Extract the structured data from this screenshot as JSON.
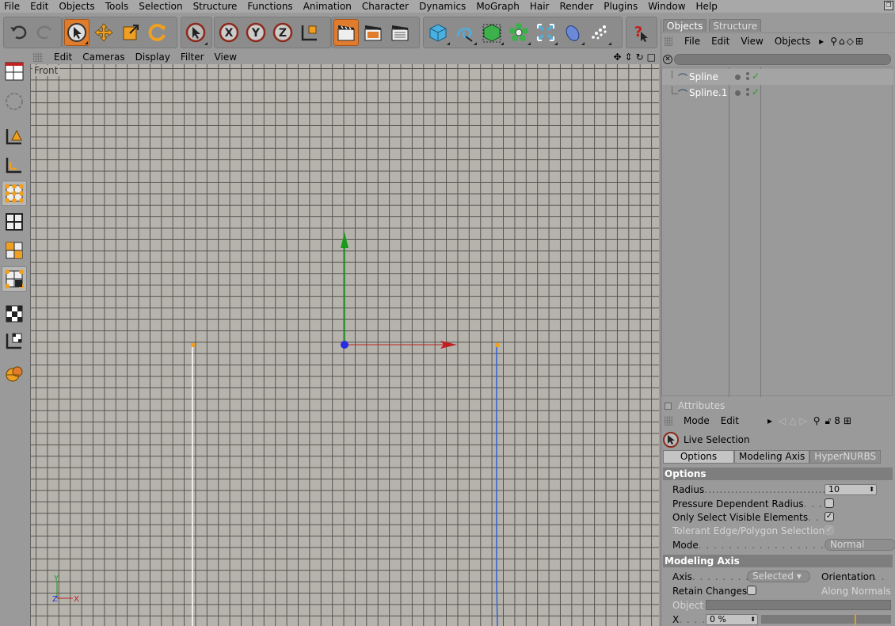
{
  "menubar": {
    "items": [
      "File",
      "Edit",
      "Objects",
      "Tools",
      "Selection",
      "Structure",
      "Functions",
      "Animation",
      "Character",
      "Dynamics",
      "MoGraph",
      "Hair",
      "Render",
      "Plugins",
      "Window",
      "Help"
    ]
  },
  "toolbar": {
    "icons": [
      "undo-icon",
      "redo-icon",
      "live-selection-icon",
      "move-icon",
      "scale-icon",
      "rotate-icon",
      "selected-tool-icon",
      "x-axis-icon",
      "y-axis-icon",
      "z-axis-icon",
      "coordinate-system-icon",
      "render-view-icon",
      "render-picture-viewer-icon",
      "render-settings-icon",
      "cube-icon",
      "spline-pen-icon",
      "nurbs-icon",
      "modeling-array-icon",
      "deformer-icon",
      "scene-floor-icon",
      "particle-icon",
      "help-icon"
    ],
    "x_label": "X",
    "y_label": "Y",
    "z_label": "Z"
  },
  "viewport": {
    "menu": [
      "Edit",
      "Cameras",
      "Display",
      "Filter",
      "View"
    ],
    "view_name": "Front",
    "axis_labels": {
      "x": "X",
      "y": "Y",
      "z": "Z"
    }
  },
  "objects_panel": {
    "tabs": [
      "Objects",
      "Structure"
    ],
    "menu": [
      "File",
      "Edit",
      "View",
      "Objects"
    ],
    "objects": [
      {
        "name": "Spline"
      },
      {
        "name": "Spline.1"
      }
    ]
  },
  "attributes_panel": {
    "title": "Attributes",
    "menu": [
      "Mode",
      "Edit"
    ],
    "tool_name": "Live Selection",
    "tabs": [
      "Options",
      "Modeling Axis",
      "HyperNURBS"
    ],
    "options_section": "Options",
    "radius_label": "Radius",
    "radius_value": "10",
    "pressure_label": "Pressure Dependent Radius",
    "only_visible_label": "Only Select Visible Elements",
    "only_visible_checked": "✓",
    "tolerant_label": "Tolerant Edge/Polygon Selection",
    "tolerant_checked": "✓",
    "mode_label": "Mode",
    "mode_value": "Normal",
    "modeling_axis_section": "Modeling Axis",
    "axis_label": "Axis",
    "axis_value": "Selected",
    "orientation_label": "Orientation",
    "retain_label": "Retain Changes",
    "along_normals": "Along Normals",
    "object_label": "Object",
    "x_label": "X",
    "x_value": "0 %"
  },
  "colors": {
    "accent": "#e07c2d",
    "grid_bg": "#b6b3ad",
    "y_axis": "#1a9a1a",
    "x_axis": "#c02020",
    "origin": "#2a2ae0",
    "spline_point": "#f0a020",
    "spline_white": "#ffffff",
    "spline_blue": "#3060d0"
  }
}
